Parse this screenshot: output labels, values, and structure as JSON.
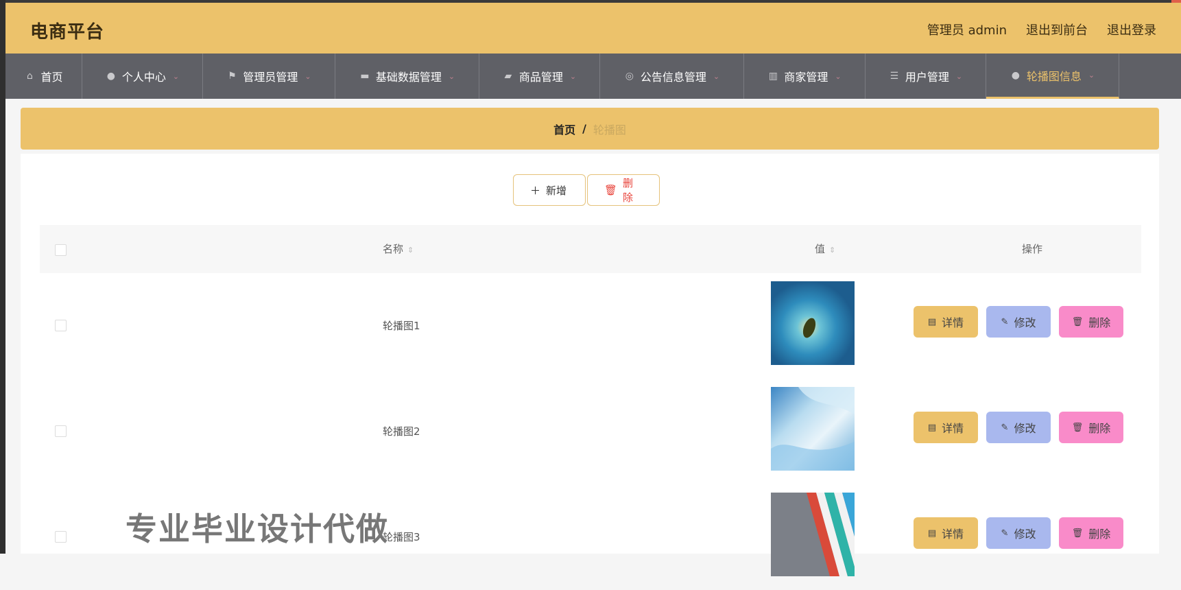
{
  "header": {
    "brand": "电商平台",
    "admin_label": "管理员 admin",
    "exit_front": "退出到前台",
    "logout": "退出登录"
  },
  "nav": [
    {
      "label": "首页",
      "icon": "home-icon"
    },
    {
      "label": "个人中心",
      "icon": "user-icon"
    },
    {
      "label": "管理员管理",
      "icon": "flag-icon"
    },
    {
      "label": "基础数据管理",
      "icon": "data-icon"
    },
    {
      "label": "商品管理",
      "icon": "goods-icon"
    },
    {
      "label": "公告信息管理",
      "icon": "notice-icon"
    },
    {
      "label": "商家管理",
      "icon": "shop-icon"
    },
    {
      "label": "用户管理",
      "icon": "list-icon"
    },
    {
      "label": "轮播图信息",
      "icon": "user-icon"
    }
  ],
  "breadcrumb": {
    "home": "首页",
    "sep": "/",
    "current": "轮播图"
  },
  "toolbar": {
    "add": "新增",
    "delete": "删除"
  },
  "table": {
    "columns": {
      "name": "名称",
      "value": "值",
      "ops": "操作"
    },
    "rows": [
      {
        "name": "轮播图1"
      },
      {
        "name": "轮播图2"
      },
      {
        "name": "轮播图3"
      }
    ],
    "actions": {
      "detail": "详情",
      "edit": "修改",
      "remove": "删除"
    }
  },
  "watermark": "专业毕业设计代做",
  "colors": {
    "accent": "#ecc26b",
    "nav_bg": "#5f6066",
    "edit": "#a9b8ee",
    "remove": "#f98bc9",
    "danger": "#e8433a"
  }
}
